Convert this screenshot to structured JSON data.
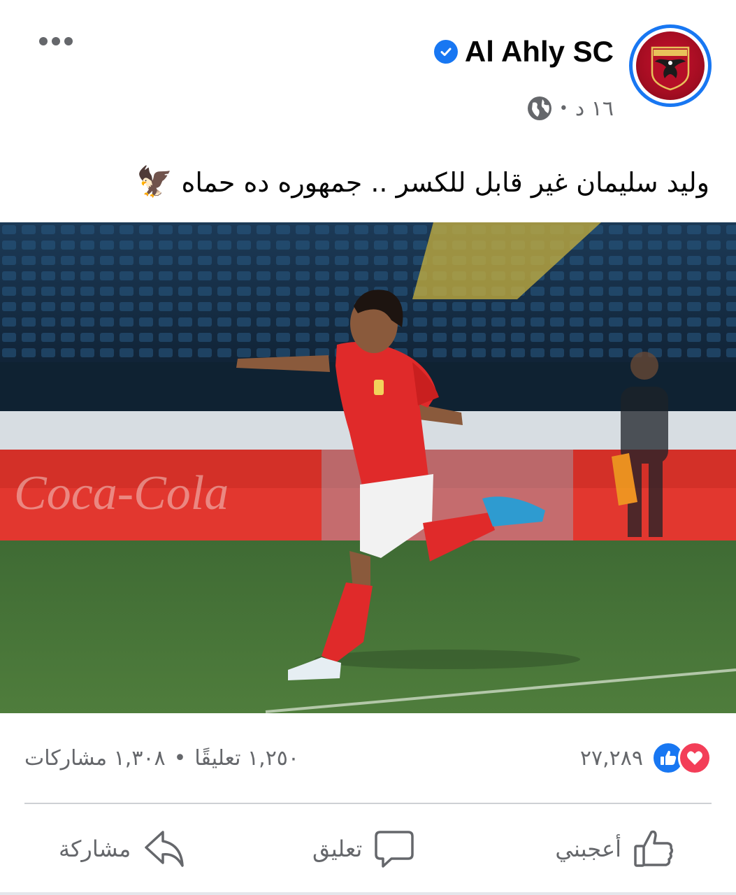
{
  "header": {
    "page_name": "Al Ahly SC",
    "time": "١٦ د",
    "separator": "•"
  },
  "caption": {
    "text": "وليد سليمان غير قابل للكسر .. جمهوره ده حماه",
    "emoji": "🦅"
  },
  "stats": {
    "reaction_count": "٢٧,٢٨٩",
    "comments": "١,٢٥٠ تعليقًا",
    "separator": "•",
    "shares": "١,٣٠٨ مشاركات"
  },
  "actions": {
    "like_label": "أعجبني",
    "comment_label": "تعليق",
    "share_label": "مشاركة"
  },
  "icons": {
    "more": "more-dots-icon",
    "verified": "verified-badge-icon",
    "audience": "globe-icon",
    "reactions": [
      "love-reaction-icon",
      "like-reaction-icon"
    ],
    "like": "thumbs-up-icon",
    "comment": "speech-bubble-icon",
    "share": "share-arrow-icon"
  },
  "colors": {
    "accent": "#1877f2",
    "love": "#f33e58",
    "club_red": "#c8102e",
    "muted_text": "#65676b"
  }
}
